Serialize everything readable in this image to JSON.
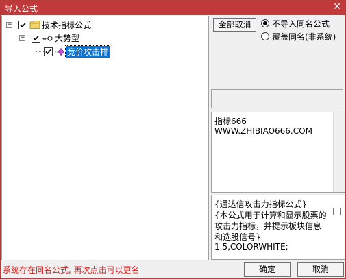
{
  "window": {
    "title": "导入公式",
    "close_glyph": "✕"
  },
  "tree": {
    "root": {
      "label": "技术指标公式",
      "checked": true,
      "icon": "folder-icon"
    },
    "group": {
      "label": "大势型",
      "checked": true,
      "icon": "key-icon"
    },
    "item": {
      "label": "竞价攻击排",
      "checked": true,
      "icon": "diamond-icon",
      "selected": true
    }
  },
  "options": {
    "deselect_all_label": "全部取消",
    "radio_skip_label": "不导入同名公式",
    "radio_overwrite_label": "覆盖同名(非系统)",
    "selected_radio": "skip"
  },
  "info": {
    "lines": [
      "指标666",
      "WWW.ZHIBIAO666.COM"
    ]
  },
  "code": {
    "lines": [
      "{通达信攻击力指标公式}",
      "{本公式用于计算和显示股票的",
      "攻击力指标，并提示板块信息",
      "和选股信号}",
      "1.5,COLORWHITE;"
    ]
  },
  "footer": {
    "status_text": "系统存在同名公式, 再次点击可以更名",
    "ok_label": "确定",
    "cancel_label": "取消"
  },
  "colors": {
    "titlebar": "#c0393b",
    "selection": "#0a74d6",
    "status_text": "#d61f1f"
  }
}
